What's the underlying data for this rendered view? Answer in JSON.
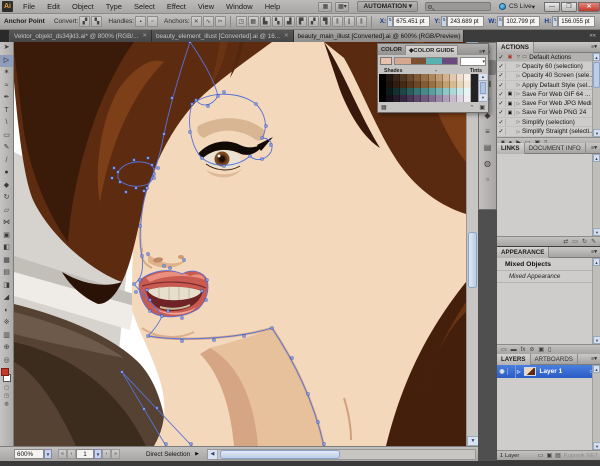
{
  "titlebar": {
    "logo": "Ai",
    "menus": [
      "File",
      "Edit",
      "Object",
      "Type",
      "Select",
      "Effect",
      "View",
      "Window",
      "Help"
    ],
    "app_icons": [
      "bridge-icon",
      "arrange-documents-icon"
    ],
    "automation": "AUTOMATION",
    "cslive": "CS Live",
    "search_placeholder": ""
  },
  "controlbar": {
    "mode_label": "Anchor Point",
    "groups": [
      {
        "label": "Convert:",
        "icons": [
          {
            "name": "convert-corner-icon",
            "glyph": "▞"
          },
          {
            "name": "convert-smooth-icon",
            "glyph": "▚"
          }
        ]
      },
      {
        "label": "Handles:",
        "icons": [
          {
            "name": "handles-show-icon",
            "glyph": "▪"
          },
          {
            "name": "handles-hide-icon",
            "glyph": "▫"
          }
        ]
      },
      {
        "label": "Anchors:",
        "icons": [
          {
            "name": "remove-anchor-icon",
            "glyph": "✕"
          },
          {
            "name": "connect-path-icon",
            "glyph": "∿"
          },
          {
            "name": "cut-path-icon",
            "glyph": "✂"
          }
        ]
      }
    ],
    "misc_icons": [
      {
        "name": "isolate-object-icon",
        "glyph": "◳"
      },
      {
        "name": "recolor-artwork-icon",
        "glyph": "▦"
      },
      {
        "name": "align-left-icon",
        "glyph": "▙"
      },
      {
        "name": "align-center-icon",
        "glyph": "▚"
      },
      {
        "name": "align-right-icon",
        "glyph": "▟"
      },
      {
        "name": "align-top-icon",
        "glyph": "▛"
      },
      {
        "name": "align-middle-icon",
        "glyph": "▞"
      },
      {
        "name": "align-bottom-icon",
        "glyph": "▜"
      },
      {
        "name": "distribute-left-icon",
        "glyph": "⫼"
      },
      {
        "name": "distribute-center-icon",
        "glyph": "∥"
      },
      {
        "name": "distribute-right-icon",
        "glyph": "⫼"
      }
    ],
    "fields": [
      {
        "label": "X:",
        "value": "675.451 pt"
      },
      {
        "label": "Y:",
        "value": "243.689 pt"
      },
      {
        "label": "W:",
        "value": "102.799 pt"
      },
      {
        "label": "H:",
        "value": "156.055 pt"
      }
    ]
  },
  "tabs": [
    {
      "label": "Vektor_objekt_ds34jkl3.ai* @ 800% (RGB/...",
      "active": false
    },
    {
      "label": "beauty_element_illust [Converted].ai @ 16...",
      "active": false
    },
    {
      "label": "beauty_main_illust [Converted].ai @ 600% (RGB/Preview)",
      "active": true
    }
  ],
  "toolbar_tools": [
    {
      "name": "selection-tool",
      "glyph": "➤"
    },
    {
      "name": "direct-selection-tool",
      "glyph": "▷",
      "selected": true
    },
    {
      "name": "magic-wand-tool",
      "glyph": "✶"
    },
    {
      "name": "lasso-tool",
      "glyph": "≈"
    },
    {
      "name": "pen-tool",
      "glyph": "✒"
    },
    {
      "name": "type-tool",
      "glyph": "T"
    },
    {
      "name": "line-tool",
      "glyph": "\\"
    },
    {
      "name": "rectangle-tool",
      "glyph": "▭"
    },
    {
      "name": "paintbrush-tool",
      "glyph": "✎"
    },
    {
      "name": "pencil-tool",
      "glyph": "/"
    },
    {
      "name": "blob-brush-tool",
      "glyph": "●"
    },
    {
      "name": "eraser-tool",
      "glyph": "◆"
    },
    {
      "name": "rotate-tool",
      "glyph": "↻"
    },
    {
      "name": "scale-tool",
      "glyph": "▱"
    },
    {
      "name": "width-tool",
      "glyph": "⋈"
    },
    {
      "name": "free-transform-tool",
      "glyph": "▣"
    },
    {
      "name": "shape-builder-tool",
      "glyph": "◧"
    },
    {
      "name": "perspective-grid-tool",
      "glyph": "▦"
    },
    {
      "name": "mesh-tool",
      "glyph": "▤"
    },
    {
      "name": "gradient-tool",
      "glyph": "◨"
    },
    {
      "name": "eyedropper-tool",
      "glyph": "◢"
    },
    {
      "name": "blend-tool",
      "glyph": "◐"
    },
    {
      "name": "symbol-sprayer-tool",
      "glyph": "※"
    },
    {
      "name": "column-graph-tool",
      "glyph": "▥"
    },
    {
      "name": "hand-tool",
      "glyph": "⊕"
    },
    {
      "name": "zoom-tool",
      "glyph": "◎"
    }
  ],
  "color_guide_panel": {
    "tabs": [
      {
        "label": "COLOR",
        "active": false
      },
      {
        "label": "◆COLOR GUIDE",
        "active": true
      }
    ],
    "shades_label": "Shades",
    "tints_label": "Tints",
    "base_swatch": "#e8c2ac",
    "variation_colors": [
      "#d4a890",
      "#7c5132",
      "#58b1b1",
      "#6b4a7d"
    ],
    "grid": [
      [
        "#000000",
        "#201611",
        "#382619",
        "#503722",
        "#68482c",
        "#805a38",
        "#987048",
        "#ac865c",
        "#c09c74",
        "#d2b292",
        "#e2c8b0",
        "#eedcce",
        "#f8eee4"
      ],
      [
        "#000000",
        "#1b110a",
        "#2f1d10",
        "#432a16",
        "#58381e",
        "#6d4828",
        "#825a34",
        "#977044",
        "#ad8858",
        "#c3a070",
        "#d6ba90",
        "#e6d2b4",
        "#f2e6d6"
      ],
      [
        "#000000",
        "#0b1b1b",
        "#143030",
        "#1e4646",
        "#2a5c5c",
        "#387272",
        "#488888",
        "#5c9e9e",
        "#74b2b2",
        "#90c6c6",
        "#aed8d8",
        "#cce8e8",
        "#e8f4f4"
      ],
      [
        "#000000",
        "#150e18",
        "#251a2c",
        "#362740",
        "#483654",
        "#5a4668",
        "#6e587c",
        "#836c90",
        "#9884a4",
        "#ae9eb8",
        "#c6bacc",
        "#dcd4e0",
        "#f0ecf2"
      ]
    ],
    "bottom_icons": [
      {
        "name": "limit-colors-icon",
        "glyph": "▦"
      },
      {
        "name": "edit-colors-icon",
        "glyph": "◔"
      },
      {
        "name": "save-to-swatches-icon",
        "glyph": "▣"
      }
    ]
  },
  "dock_icons": [
    {
      "name": "color-icon",
      "glyph": "✎"
    },
    {
      "name": "color-guide-icon",
      "glyph": "◑",
      "selected": true
    },
    {
      "name": "swatches-icon",
      "glyph": "▦"
    },
    {
      "name": "brushes-icon",
      "glyph": "✒"
    },
    {
      "name": "symbols-icon",
      "glyph": "◆"
    },
    {
      "name": "stroke-icon",
      "glyph": "≡"
    },
    {
      "name": "gradient-icon",
      "glyph": "▤"
    },
    {
      "name": "transparency-icon",
      "glyph": "◍"
    },
    {
      "name": "graphic-styles-icon",
      "glyph": "▫"
    }
  ],
  "actions_panel": {
    "title": "ACTIONS",
    "items": [
      {
        "label": "Default Actions",
        "set": true,
        "checked": true,
        "dialog": true,
        "selected": true
      },
      {
        "label": "Opacity 60 (selection)",
        "checked": true,
        "dialog": false
      },
      {
        "label": "Opacity 40 Screen (sele...",
        "checked": true,
        "dialog": false
      },
      {
        "label": "Apply Default Style (sel...",
        "checked": true,
        "dialog": false
      },
      {
        "label": "Save For Web GIF 64 ...",
        "checked": true,
        "dialog": true
      },
      {
        "label": "Save For Web JPG Medi...",
        "checked": true,
        "dialog": true
      },
      {
        "label": "Save For Web PNG 24",
        "checked": true,
        "dialog": true
      },
      {
        "label": "Simplify (selection)",
        "checked": true,
        "dialog": false
      },
      {
        "label": "Simplify Straight (selecti...",
        "checked": true,
        "dialog": false
      }
    ],
    "bottom_icons": [
      {
        "name": "stop-icon",
        "glyph": "■"
      },
      {
        "name": "record-icon",
        "glyph": "●"
      },
      {
        "name": "play-icon",
        "glyph": "▶"
      },
      {
        "name": "new-set-icon",
        "glyph": "▭"
      },
      {
        "name": "new-action-icon",
        "glyph": "▣"
      },
      {
        "name": "delete-icon",
        "glyph": "▯"
      }
    ]
  },
  "links_panel": {
    "tabs": [
      "LINKS",
      "DOCUMENT INFO"
    ],
    "bottom_icons": [
      {
        "name": "relink-icon",
        "glyph": "⇄"
      },
      {
        "name": "go-to-link-icon",
        "glyph": "▭"
      },
      {
        "name": "update-link-icon",
        "glyph": "↻"
      },
      {
        "name": "edit-original-icon",
        "glyph": "✎"
      }
    ]
  },
  "appearance_panel": {
    "title": "APPEARANCE",
    "row1": "Mixed Objects",
    "row2": "Mixed Appearance",
    "bottom_icons": [
      {
        "name": "new-stroke-icon",
        "glyph": "▭"
      },
      {
        "name": "new-fill-icon",
        "glyph": "▬"
      },
      {
        "name": "add-effect-icon",
        "glyph": "fx"
      },
      {
        "name": "clear-appearance-icon",
        "glyph": "⊘"
      },
      {
        "name": "duplicate-item-icon",
        "glyph": "▣"
      },
      {
        "name": "delete-item-icon",
        "glyph": "▯"
      }
    ]
  },
  "layers_panel": {
    "tabs": [
      "LAYERS",
      "ARTBOARDS"
    ],
    "layer_name": "Layer 1",
    "status": "1 Layer",
    "watermark": "Kuponik NET",
    "bottom_icons": [
      {
        "name": "make-mask-icon",
        "glyph": "▭"
      },
      {
        "name": "new-sublayer-icon",
        "glyph": "▣"
      },
      {
        "name": "new-layer-icon",
        "glyph": "▤"
      }
    ]
  },
  "statusbar": {
    "zoom": "600%",
    "artboard": "1",
    "status": "Direct Selection"
  }
}
